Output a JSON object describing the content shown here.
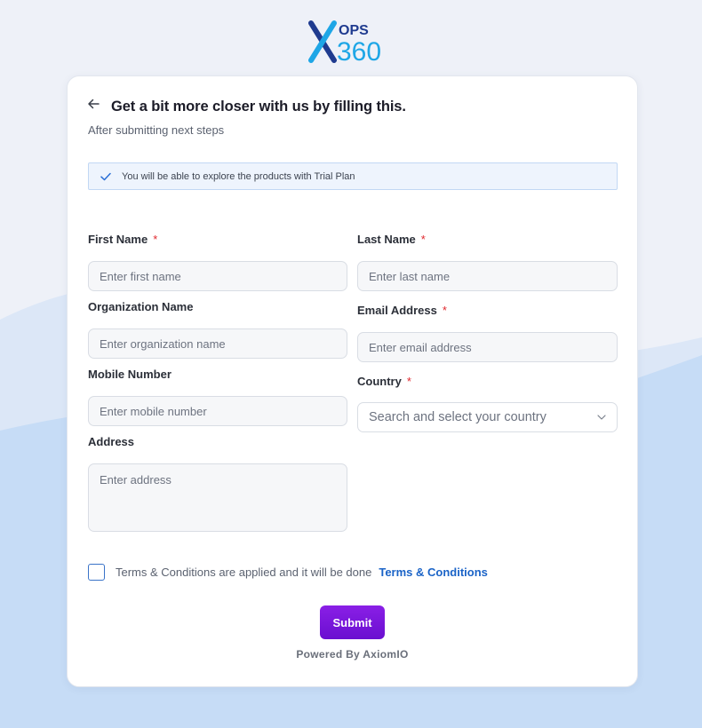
{
  "logo": {
    "top_text": "OPS",
    "bottom_text": "360"
  },
  "form": {
    "title": "Get a bit more closer with us by filling this.",
    "subtitle": "After submitting next steps",
    "info_message": "You will be able to explore the products with Trial Plan",
    "required_marker": "*",
    "first_name": {
      "label": "First Name",
      "placeholder": "Enter first name",
      "value": ""
    },
    "last_name": {
      "label": "Last Name",
      "placeholder": "Enter last name",
      "value": ""
    },
    "organization": {
      "label": "Organization Name",
      "placeholder": "Enter organization name",
      "value": ""
    },
    "email": {
      "label": "Email Address",
      "placeholder": "Enter email address",
      "value": ""
    },
    "mobile": {
      "label": "Mobile Number",
      "placeholder": "Enter mobile number",
      "value": ""
    },
    "country": {
      "label": "Country",
      "placeholder": "Search and select your country"
    },
    "address": {
      "label": "Address",
      "placeholder": "Enter address",
      "value": ""
    },
    "terms": {
      "text": "Terms & Conditions are applied and it will be done",
      "link": "Terms & Conditions",
      "checked": false
    },
    "submit_label": "Submit",
    "powered_by": "Powered By AxiomIO"
  },
  "colors": {
    "accent_purple": "#7a16dc",
    "link_blue": "#1a63c7",
    "required_red": "#e0282e",
    "logo_navy": "#1f3b8f",
    "logo_cyan": "#1ea6e6"
  },
  "icons": [
    "logo-x-mark",
    "back-arrow-icon",
    "check-icon",
    "chevron-down-icon"
  ]
}
